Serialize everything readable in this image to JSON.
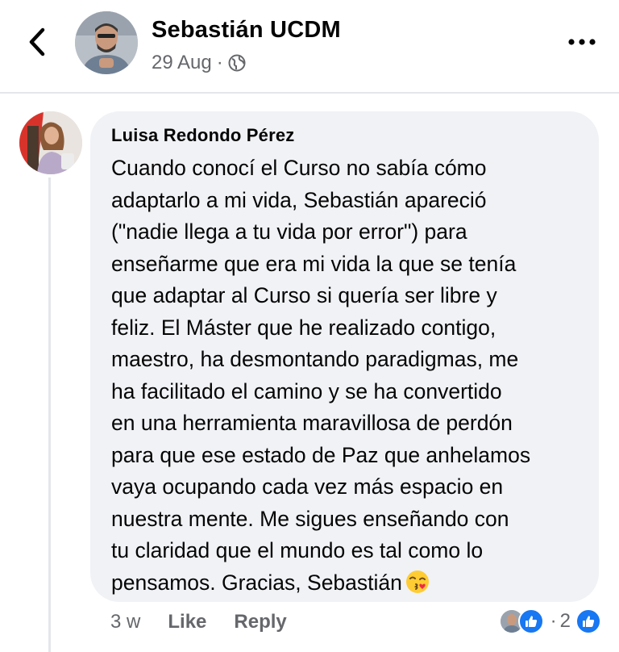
{
  "header": {
    "page_name": "Sebastián UCDM",
    "date": "29 Aug",
    "separator": "·",
    "icons": {
      "back": "chevron-left-icon",
      "privacy": "globe-icon",
      "more": "more-horizontal-icon"
    }
  },
  "comment": {
    "author": "Luisa Redondo Pérez",
    "text": "Cuando conocí el Curso no sabía cómo\nadaptarlo a mi vida, Sebastián apareció\n(\"nadie llega a tu vida por error\") para\nenseñarme que era mi vida la que se tenía\nque adaptar al Curso si quería ser libre y\nfeliz. El Máster que he realizado contigo,\nmaestro, ha desmontando paradigmas, me\nha facilitado el camino y se ha convertido\nen una herramienta maravillosa de perdón\npara que ese estado de Paz que anhelamos\nvaya ocupando cada vez más espacio en\nnuestra mente. Me sigues enseñando con\ntu claridad que el mundo es tal como lo\npensamos. Gracias, Sebastián",
    "emoji": "kissing-face-emoji",
    "time": "3 w",
    "like_label": "Like",
    "reply_label": "Reply",
    "reactions": {
      "separator": "·",
      "count": "2",
      "icon": "like-icon"
    }
  },
  "colors": {
    "bubble": "#f0f2f5",
    "muted_text": "#65676b",
    "like_blue": "#1877f2",
    "divider": "#e4e6eb"
  }
}
